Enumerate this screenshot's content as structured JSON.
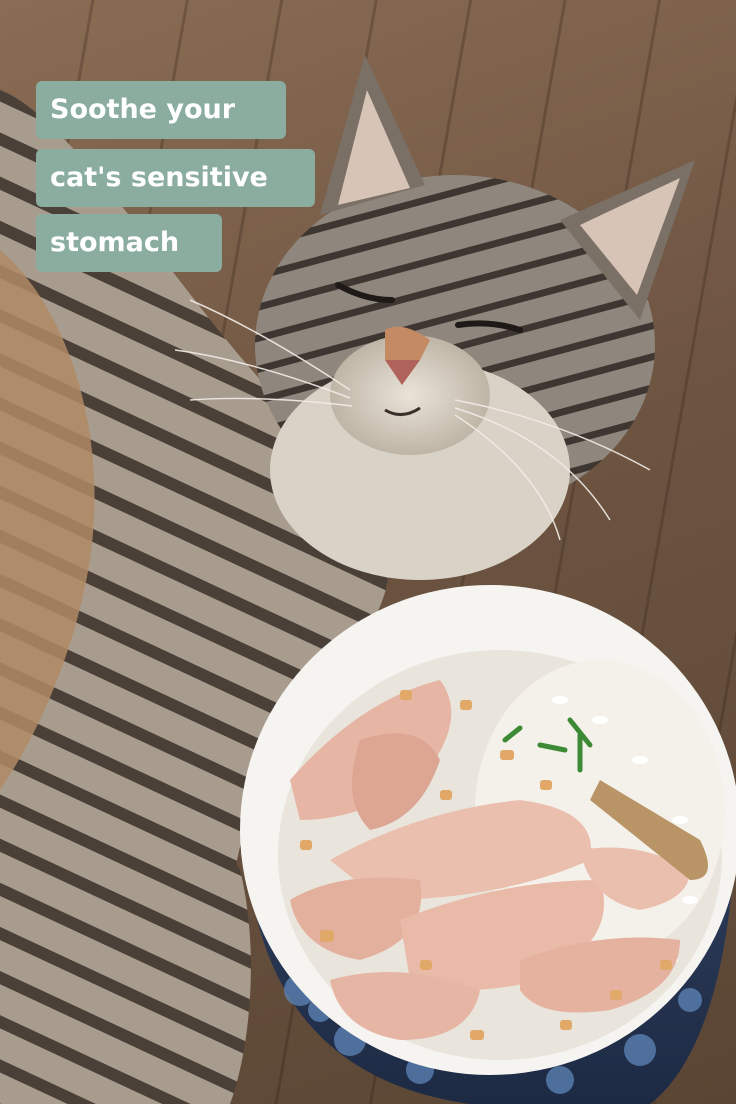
{
  "caption": {
    "lines": [
      "Soothe your",
      "cat's sensitive",
      "stomach"
    ],
    "badge_color": "#8bada0",
    "text_color": "#ffffff"
  },
  "photo": {
    "subjects": [
      "tabby-cat",
      "food-bowl"
    ],
    "bowl_contents": [
      "shredded-chicken",
      "white-rice",
      "parsley"
    ]
  }
}
